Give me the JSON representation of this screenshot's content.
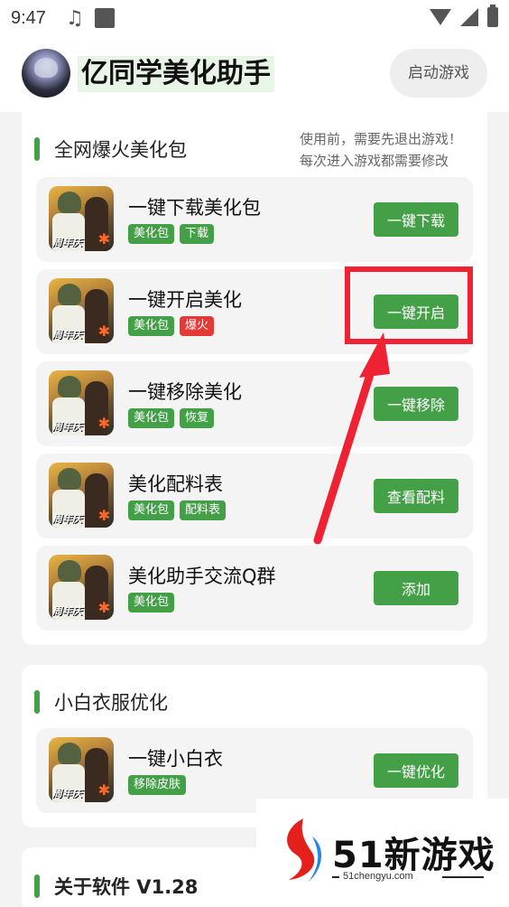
{
  "status_bar": {
    "time": "9:47",
    "music_icon": "music-note-icon"
  },
  "header": {
    "title": "亿同学美化助手",
    "launch_button": "启动游戏"
  },
  "section_beauty": {
    "title": "全网爆火美化包",
    "note_line1": "使用前，需要先退出游戏！",
    "note_line2": "每次进入游戏都需要修改",
    "items": [
      {
        "title": "一键下载美化包",
        "tags": [
          "美化包",
          "下载"
        ],
        "button": "一键下载",
        "thumb_tag": "周年庆"
      },
      {
        "title": "一键开启美化",
        "tags": [
          "美化包",
          "爆火"
        ],
        "button": "一键开启",
        "thumb_tag": "周年庆"
      },
      {
        "title": "一键移除美化",
        "tags": [
          "美化包",
          "恢复"
        ],
        "button": "一键移除",
        "thumb_tag": "周年庆"
      },
      {
        "title": "美化配料表",
        "tags": [
          "美化包",
          "配料表"
        ],
        "button": "查看配料",
        "thumb_tag": "周年庆"
      },
      {
        "title": "美化助手交流Q群",
        "tags": [
          "美化包"
        ],
        "button": "添加",
        "thumb_tag": "周年庆"
      }
    ]
  },
  "section_clothes": {
    "title": "小白衣服优化",
    "items": [
      {
        "title": "一键小白衣",
        "tags": [
          "移除皮肤"
        ],
        "button": "一键优化",
        "thumb_tag": "周年庆"
      }
    ]
  },
  "section_about": {
    "title": "关于软件 V1.28"
  },
  "watermark": {
    "brand": "51新游戏",
    "url": "51chengyu.com"
  },
  "colors": {
    "accent": "#43a047",
    "hot_tag": "#e53935",
    "annotation": "#ee2233"
  }
}
